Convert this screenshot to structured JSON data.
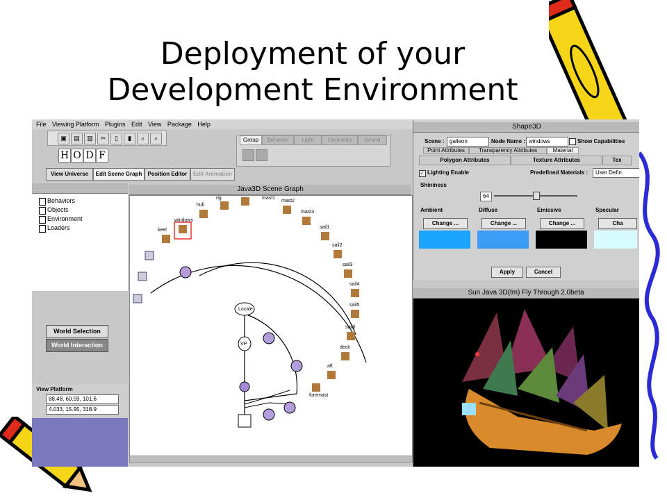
{
  "slide": {
    "title_line1": "Deployment of your",
    "title_line2": "Development Environment"
  },
  "menu": [
    "File",
    "Viewing Platform",
    "Plugins",
    "Edit",
    "View",
    "Package",
    "Help"
  ],
  "hodf": [
    "H",
    "O",
    "D",
    "F"
  ],
  "toolbar_icons": [
    "disk-icon",
    "copy-icon",
    "paste-icon",
    "cut-icon",
    "lock-icon",
    "trash-icon",
    "zoom-in-icon",
    "zoom-out-icon"
  ],
  "tabs": [
    "Group",
    "Behavior",
    "Light",
    "Geometry",
    "Sound"
  ],
  "modes": [
    "View Universe",
    "Edit Scene Graph",
    "Position Editor",
    "Edit Animation"
  ],
  "tree": [
    "Behaviors",
    "Objects",
    "Environment",
    "Loaders"
  ],
  "world": {
    "selection": "World Selection",
    "interaction": "World Interaction"
  },
  "view_platform": {
    "title": "View Platform",
    "position": "88.48, 60.59, 101.6",
    "orientation": "4.033, 15.95, 318.9"
  },
  "scene_graph": {
    "title": "Java3D Scene Graph",
    "locale": "Locale",
    "vp": "VP",
    "nodes": [
      "keel",
      "windows",
      "hull",
      "rig",
      "mast1",
      "mast2",
      "mast3",
      "sail1",
      "sail2",
      "sail3",
      "sail4",
      "sail5",
      "sail6",
      "deck",
      "aft",
      "foremast"
    ]
  },
  "shape3d": {
    "title": "Shape3D",
    "scene_label": "Scene :",
    "scene_value": "galleon",
    "node_label": "Node Name :",
    "node_value": "windows",
    "show_caps": "Show Capabilities",
    "tabs_row1": [
      "Point Attributes",
      "Transparency Attributes",
      "Material"
    ],
    "tabs_row2": [
      "Polygon Attributes",
      "Texture Attributes",
      "Tex"
    ],
    "lighting": "Lighting Enable",
    "predefined_label": "Predefined Materials :",
    "predefined_value": "User Defin",
    "shininess": "Shininess",
    "shininess_value": "64",
    "materials": [
      {
        "name": "Ambient",
        "button": "Change ...",
        "color": "#1aa3ff"
      },
      {
        "name": "Diffuse",
        "button": "Change ...",
        "color": "#3b9cf5"
      },
      {
        "name": "Emissive",
        "button": "Change ...",
        "color": "#000000"
      },
      {
        "name": "Specular",
        "button": "Cha",
        "color": "#d8fbff"
      }
    ],
    "apply": "Apply",
    "cancel": "Cancel"
  },
  "flythrough": {
    "title": "Sun Java 3D(tm) Fly Through 2.0beta"
  },
  "colors": {
    "pencil_yellow": "#f5d516",
    "pencil_red": "#e02a1a",
    "ship_hull": "#d98a2a"
  }
}
